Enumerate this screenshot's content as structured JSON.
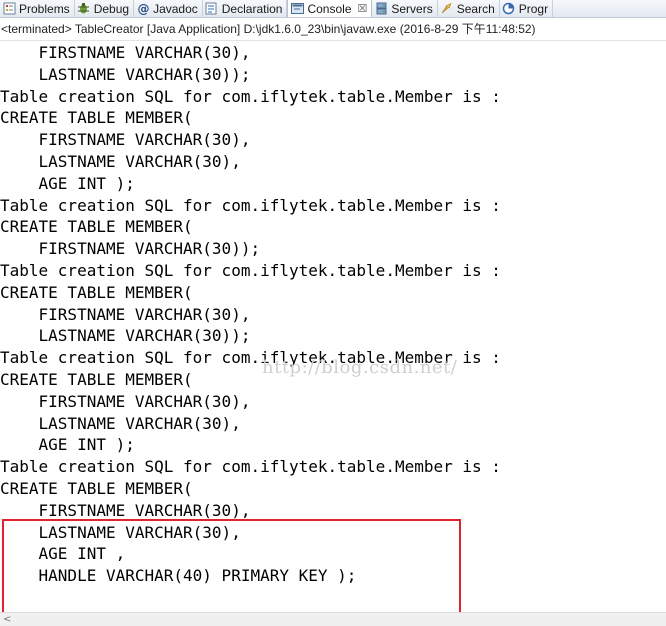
{
  "tabs": [
    {
      "label": "Problems",
      "icon": "problems-icon",
      "active": false
    },
    {
      "label": "Debug",
      "icon": "debug-icon",
      "active": false
    },
    {
      "label": "Javadoc",
      "icon": "javadoc-icon",
      "active": false
    },
    {
      "label": "Declaration",
      "icon": "declaration-icon",
      "active": false
    },
    {
      "label": "Console",
      "icon": "console-icon",
      "active": true,
      "close": "☒"
    },
    {
      "label": "Servers",
      "icon": "servers-icon",
      "active": false
    },
    {
      "label": "Search",
      "icon": "search-icon",
      "active": false
    },
    {
      "label": "Progr",
      "icon": "progress-icon",
      "active": false
    }
  ],
  "status": "<terminated> TableCreator [Java Application] D:\\jdk1.6.0_23\\bin\\javaw.exe (2016-8-29 下午11:48:52)",
  "console_lines": [
    "    FIRSTNAME VARCHAR(30),",
    "    LASTNAME VARCHAR(30));",
    "Table creation SQL for com.iflytek.table.Member is :",
    "CREATE TABLE MEMBER(",
    "    FIRSTNAME VARCHAR(30),",
    "    LASTNAME VARCHAR(30),",
    "    AGE INT );",
    "Table creation SQL for com.iflytek.table.Member is :",
    "CREATE TABLE MEMBER(",
    "    FIRSTNAME VARCHAR(30));",
    "Table creation SQL for com.iflytek.table.Member is :",
    "CREATE TABLE MEMBER(",
    "    FIRSTNAME VARCHAR(30),",
    "    LASTNAME VARCHAR(30));",
    "Table creation SQL for com.iflytek.table.Member is :",
    "CREATE TABLE MEMBER(",
    "    FIRSTNAME VARCHAR(30),",
    "    LASTNAME VARCHAR(30),",
    "    AGE INT );",
    "Table creation SQL for com.iflytek.table.Member is :",
    "CREATE TABLE MEMBER(",
    "    FIRSTNAME VARCHAR(30),",
    "    LASTNAME VARCHAR(30),",
    "    AGE INT ,",
    "    HANDLE VARCHAR(40) PRIMARY KEY );"
  ],
  "watermark": "http://blog.csdn.net/",
  "colors": {
    "highlight": "#e0232e",
    "text": "#000000",
    "watermark": "#cfcfcf"
  }
}
